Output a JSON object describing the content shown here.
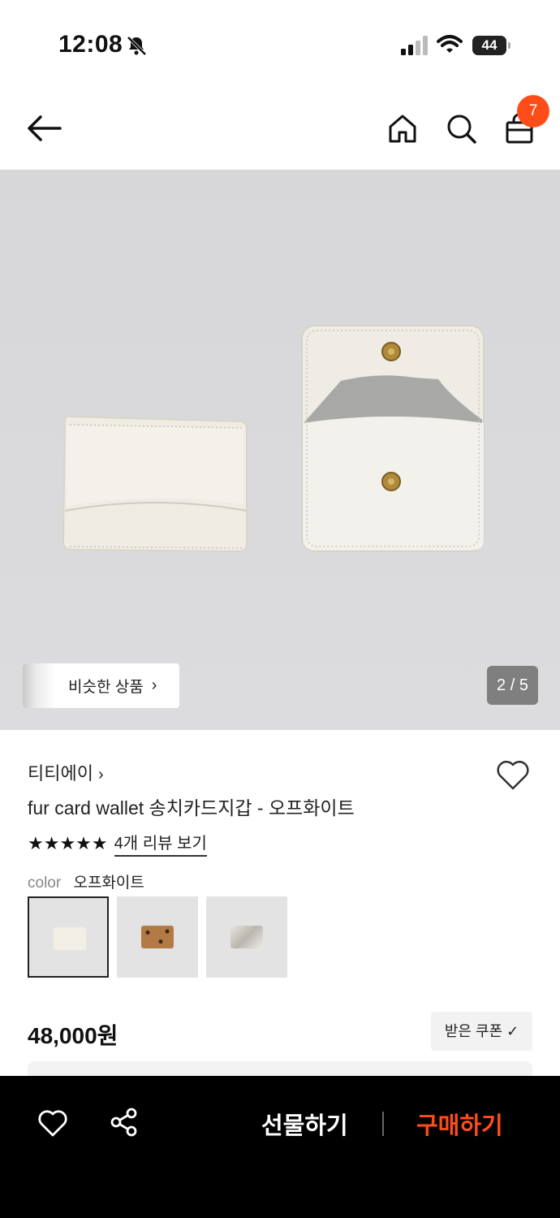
{
  "status_bar": {
    "time": "12:08",
    "battery": "44",
    "icons": [
      "bell-off-icon",
      "signal-icon",
      "wifi-icon",
      "battery-icon"
    ]
  },
  "header": {
    "icons": [
      "back-arrow-icon",
      "home-icon",
      "search-icon",
      "shopping-bag-icon"
    ],
    "cart_count": "7"
  },
  "hero": {
    "similar_label": "비슷한 상품",
    "page_indicator": "2 / 5",
    "background_color": "#d9d9db"
  },
  "product": {
    "brand": "티티에이",
    "title": "fur card wallet 송치카드지갑 - 오프화이트",
    "stars": "★★★★★",
    "rating": 5,
    "review_link": "4개 리뷰 보기",
    "option_label": "color",
    "option_value": "오프화이트",
    "swatches": [
      {
        "name": "오프화이트",
        "color": "#f1efe6"
      },
      {
        "name": "leopard",
        "color": "#a06a3a"
      },
      {
        "name": "silver",
        "color": "#c8c6c0"
      }
    ],
    "price": "48,000원",
    "coupon_label": "받은 쿠폰 ✓"
  },
  "bottom_bar": {
    "gift_label": "선물하기",
    "buy_label": "구매하기",
    "accent_color": "#ff4d1a"
  }
}
